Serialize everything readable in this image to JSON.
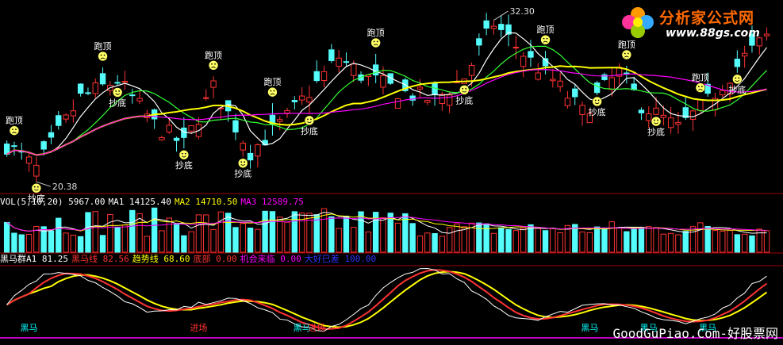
{
  "brand": {
    "name": "分析家公式网",
    "url": "www.88gs.com"
  },
  "watermark": "GoodGuPiao.Com-好股票网",
  "chart_data": [
    {
      "type": "candlestick",
      "panel": "price",
      "high_label": "32.30",
      "low_label": "20.38",
      "signals": [
        {
          "bar": 1,
          "label": "跑顶"
        },
        {
          "bar": 4,
          "label": "抄底"
        },
        {
          "bar": 13,
          "label": "跑顶"
        },
        {
          "bar": 15,
          "label": "抄底"
        },
        {
          "bar": 24,
          "label": "抄底"
        },
        {
          "bar": 28,
          "label": "跑顶"
        },
        {
          "bar": 32,
          "label": "抄底"
        },
        {
          "bar": 36,
          "label": "跑顶"
        },
        {
          "bar": 41,
          "label": "抄底"
        },
        {
          "bar": 50,
          "label": "跑顶"
        },
        {
          "bar": 62,
          "label": "抄底"
        },
        {
          "bar": 73,
          "label": "跑顶"
        },
        {
          "bar": 80,
          "label": "抄底"
        },
        {
          "bar": 84,
          "label": "跑顶"
        },
        {
          "bar": 88,
          "label": "抄底"
        },
        {
          "bar": 94,
          "label": "跑顶"
        },
        {
          "bar": 99,
          "label": "抄底"
        }
      ]
    },
    {
      "type": "bar",
      "panel": "volume",
      "title": "VOL(5,10,20)",
      "current_volume": "5967.00",
      "ma_labels": [
        {
          "name": "MA1",
          "value": "14125.40",
          "color": "#ffffff"
        },
        {
          "name": "MA2",
          "value": "14710.50",
          "color": "#ffff00"
        },
        {
          "name": "MA3",
          "value": "12589.75",
          "color": "#ff00ff"
        }
      ]
    },
    {
      "type": "line",
      "panel": "indicator",
      "legend": [
        {
          "name": "黑马群A1",
          "value": "81.25",
          "color": "#ffffff"
        },
        {
          "name": "黑马线",
          "value": "82.56",
          "color": "#ff3333"
        },
        {
          "name": "趋势线",
          "value": "68.60",
          "color": "#ffff00"
        },
        {
          "name": "底部",
          "value": "0.00",
          "color": "#ff3333"
        },
        {
          "name": "机会来临",
          "value": "0.00",
          "color": "#ff00ff"
        },
        {
          "name": "大好已差",
          "value": "100.00",
          "color": "#3333ff"
        }
      ],
      "annotations": [
        {
          "bar": 3,
          "label": "黑马",
          "color": "#00ffff"
        },
        {
          "bar": 26,
          "label": "进场",
          "color": "#ff3333"
        },
        {
          "bar": 40,
          "label": "黑马",
          "color": "#00ffff"
        },
        {
          "bar": 42,
          "label": "进场",
          "color": "#ff3333"
        },
        {
          "bar": 79,
          "label": "黑马",
          "color": "#00ffff"
        },
        {
          "bar": 87,
          "label": "黑马",
          "color": "#00ffff"
        },
        {
          "bar": 95,
          "label": "黑马",
          "color": "#00ffff"
        }
      ]
    }
  ]
}
